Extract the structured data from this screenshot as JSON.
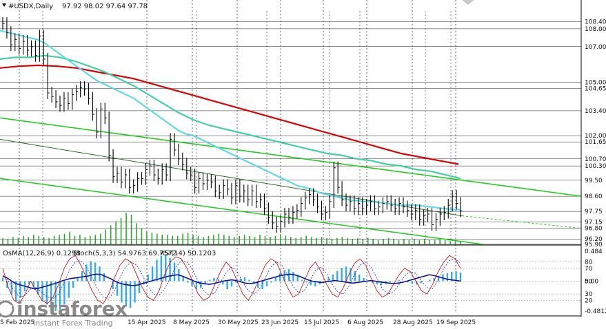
{
  "header": {
    "symbol": "#USDX,Daily",
    "ohlc": "97.92 98.02 97.64 97.78"
  },
  "indicator_header": {
    "osma": "OsMA(12,26,9) 0.1298",
    "stoch": "Stoch(5,3,3) 54.9763 69.7572",
    "rsi": "RSI(14) 50.1203"
  },
  "watermark": {
    "brand": "instaforex",
    "tagline": "Instant Forex Trading"
  },
  "colors": {
    "price": "#000000",
    "ma_fast": "#5fd8e8",
    "ma_mid": "#3fd2a0",
    "ma_slow": "#dd0000",
    "channel": "#22cc22",
    "volume": "#2ea52e",
    "osma_hist": "#33aaee",
    "stoch_main": "#cc0000",
    "stoch_signal": "#2222aa",
    "rsi": "#111199",
    "grid": "#000000"
  },
  "chart_data": [
    {
      "type": "line",
      "name": "#USDX,Daily",
      "price_levels": [
        "108.40",
        "108.00",
        "107.00",
        "105.00",
        "104.65",
        "103.40",
        "102.00",
        "101.65",
        "100.70",
        "100.30",
        "99.50",
        "98.60",
        "97.75",
        "97.15",
        "96.80",
        "96.20",
        "95.90"
      ],
      "ylim": [
        95.9,
        109
      ],
      "x_ticks": [
        "5 Feb 2025",
        "15 Apr 2025",
        "8 May 2025",
        "30 May 2025",
        "23 Jun 2025",
        "15 Jul 2025",
        "6 Aug 2025",
        "28 Aug 2025",
        "19 Sep 2025"
      ],
      "close": [
        108.3,
        107.8,
        107.1,
        107.4,
        106.9,
        107.3,
        106.8,
        107.0,
        106.5,
        107.6,
        106.3,
        104.4,
        104.2,
        103.9,
        103.7,
        104.1,
        103.8,
        104.3,
        104.5,
        104.7,
        104.6,
        104.1,
        103.2,
        102.2,
        103.5,
        103.0,
        100.9,
        99.7,
        99.9,
        99.4,
        99.8,
        99.1,
        99.2,
        99.6,
        99.6,
        100.1,
        100.3,
        99.8,
        99.6,
        100.1,
        99.8,
        101.8,
        101.2,
        100.7,
        100.4,
        99.9,
        99.8,
        99.1,
        99.6,
        99.3,
        99.5,
        99.4,
        98.9,
        98.8,
        99.2,
        99.0,
        98.5,
        99.2,
        98.6,
        98.9,
        98.4,
        98.9,
        98.3,
        98.4,
        97.9,
        97.4,
        97.1,
        96.9,
        97.2,
        97.6,
        97.4,
        97.7,
        97.8,
        98.2,
        98.5,
        98.7,
        98.4,
        98.0,
        97.6,
        97.7,
        98.3,
        100.2,
        99.1,
        98.4,
        98.1,
        98.3,
        97.9,
        98.2,
        97.9,
        98.1,
        98.3,
        97.9,
        98.0,
        98.2,
        98.3,
        98.1,
        97.9,
        98.2,
        98.0,
        97.8,
        97.6,
        97.8,
        97.3,
        97.5,
        97.6,
        97.0,
        97.3,
        97.6,
        97.7,
        98.1,
        98.6,
        98.2,
        97.78
      ],
      "ma_fast": [
        107.9,
        107.8,
        107.7,
        107.6,
        107.5,
        107.4,
        107.2,
        106.9,
        106.6,
        106.3,
        106.0,
        105.7,
        105.4,
        105.1,
        104.9,
        104.7,
        104.5,
        104.3,
        104.1,
        103.8,
        103.5,
        103.2,
        102.9,
        102.6,
        102.3,
        102.1,
        102.0,
        101.8,
        101.6,
        101.4,
        101.2,
        101.0,
        100.8,
        100.6,
        100.4,
        100.2,
        100.0,
        99.8,
        99.6,
        99.4,
        99.2,
        99.1,
        99.0,
        98.8,
        98.7,
        98.6,
        98.5,
        98.4,
        98.35,
        98.3,
        98.3,
        98.25,
        98.2,
        98.15,
        98.1,
        98.1,
        98.1,
        98.05,
        98.0,
        97.95,
        97.9,
        97.85,
        97.85
      ],
      "ma_mid": [
        106.3,
        106.4,
        106.4,
        106.5,
        106.4,
        106.2,
        105.9,
        105.6,
        105.2,
        104.8,
        104.3,
        103.8,
        103.3,
        102.9,
        102.6,
        102.4,
        102.2,
        102.0,
        101.8,
        101.6,
        101.4,
        101.2,
        101.0,
        100.9,
        100.7,
        100.6,
        100.4,
        100.3,
        100.1,
        100.0,
        99.8,
        99.6
      ],
      "ma_slow": [
        105.8,
        105.9,
        105.95,
        105.9,
        105.8,
        105.6,
        105.4,
        105.2,
        104.9,
        104.6,
        104.3,
        104.0,
        103.7,
        103.4,
        103.1,
        102.8,
        102.5,
        102.2,
        101.9,
        101.6,
        101.3,
        101.0,
        100.8,
        100.6,
        100.4
      ],
      "volume": [
        6,
        5,
        7,
        6,
        8,
        7,
        9,
        8,
        7,
        6,
        8,
        9,
        10,
        12,
        8,
        9,
        7,
        8,
        9,
        10,
        14,
        18,
        22,
        25,
        30,
        28,
        20,
        15,
        12,
        11,
        10,
        9,
        9,
        8,
        8,
        10,
        11,
        9,
        8,
        7,
        8,
        9,
        10,
        9,
        8,
        7,
        8,
        9,
        8,
        7,
        9,
        8,
        7,
        8,
        9,
        8,
        7,
        6,
        7,
        8,
        7,
        6,
        7,
        6,
        5,
        6,
        7,
        6,
        5,
        6,
        5,
        6,
        5,
        4,
        5,
        6,
        5,
        4,
        5,
        4,
        5,
        4,
        5,
        4,
        4,
        5,
        4,
        3,
        4,
        3
      ]
    },
    {
      "type": "line",
      "name": "OsMA(12,26,9) 0.1298 / Stoch(5,3,3) 54.9763 69.7572 / RSI(14) 50.1203",
      "y_labels": [
        "0.484",
        "80",
        "70",
        "0.00",
        "50",
        "30",
        "20",
        "-0.4812"
      ],
      "osma": [
        0.05,
        -0.1,
        -0.2,
        -0.3,
        -0.25,
        -0.15,
        -0.05,
        -0.1,
        -0.2,
        -0.3,
        -0.35,
        -0.4,
        -0.45,
        -0.42,
        -0.35,
        -0.25,
        -0.1,
        0.05,
        0.15,
        0.25,
        0.3,
        0.28,
        0.22,
        0.12,
        0.0,
        -0.12,
        -0.22,
        -0.32,
        -0.38,
        -0.4,
        -0.32,
        -0.18,
        -0.05,
        0.1,
        0.22,
        0.32,
        0.38,
        0.4,
        0.35,
        0.28,
        0.18,
        0.08,
        -0.02,
        -0.08,
        -0.12,
        -0.1,
        -0.05,
        0.02,
        0.05,
        0.03,
        -0.05,
        -0.12,
        -0.08,
        -0.02,
        0.04,
        0.06,
        0.02,
        -0.04,
        -0.1,
        -0.12,
        -0.08,
        -0.02,
        0.06,
        0.12,
        0.16,
        0.18,
        0.14,
        0.08,
        0.02,
        -0.02,
        -0.06,
        -0.08,
        -0.05,
        0.0,
        0.05,
        0.1,
        0.15,
        0.2,
        0.22,
        0.2,
        0.15,
        0.1,
        0.05,
        0.0,
        -0.03,
        -0.05,
        -0.06,
        -0.04,
        -0.02,
        0.0,
        0.02,
        0.0,
        -0.02,
        -0.04,
        -0.05,
        -0.03,
        0.0,
        0.02,
        0.05,
        0.08,
        0.1,
        0.12,
        0.14,
        0.15,
        0.13
      ],
      "stoch_main": [
        70,
        40,
        20,
        15,
        30,
        50,
        35,
        20,
        15,
        25,
        45,
        70,
        85,
        90,
        75,
        55,
        35,
        20,
        15,
        30,
        55,
        75,
        85,
        80,
        60,
        40,
        25,
        20,
        35,
        60,
        80,
        88,
        85,
        70,
        50,
        30,
        20,
        25,
        45,
        65,
        80,
        70,
        50,
        30,
        20,
        35,
        55,
        75,
        85,
        80,
        60,
        40,
        25,
        30,
        50,
        70,
        80,
        65,
        45,
        30,
        25,
        40,
        60,
        78,
        85,
        75,
        55,
        35,
        25,
        30,
        45,
        60,
        70,
        65,
        50,
        35,
        30,
        45,
        65,
        80,
        90,
        85,
        70
      ],
      "stoch_signal": [
        60,
        50,
        35,
        25,
        28,
        38,
        40,
        32,
        25,
        23,
        30,
        48,
        68,
        80,
        82,
        72,
        55,
        38,
        25,
        22,
        35,
        55,
        72,
        80,
        75,
        60,
        42,
        30,
        28,
        38,
        55,
        72,
        82,
        80,
        68,
        50,
        35,
        28,
        32,
        48,
        63,
        72,
        65,
        48,
        35,
        30,
        38,
        55,
        72,
        80,
        75,
        60,
        42,
        32,
        35,
        50,
        67,
        72,
        62,
        45,
        33,
        30,
        42,
        60,
        75,
        80,
        72,
        55,
        38,
        30,
        33,
        45,
        58,
        65,
        62,
        50,
        40,
        38,
        52,
        70,
        82,
        85,
        78
      ],
      "rsi": [
        58,
        55,
        50,
        46,
        44,
        42,
        40,
        38,
        39,
        41,
        43,
        45,
        47,
        50,
        52,
        54,
        55,
        56,
        57,
        58,
        60,
        61,
        60,
        57,
        54,
        50,
        47,
        45,
        44,
        43,
        44,
        46,
        48,
        50,
        52,
        54,
        56,
        58,
        59,
        60,
        58,
        55,
        52,
        49,
        47,
        46,
        45,
        46,
        48,
        50,
        51,
        52,
        51,
        49,
        47,
        46,
        47,
        49,
        51,
        53,
        55,
        57,
        59,
        60,
        61,
        60,
        58,
        55,
        52,
        50,
        49,
        48,
        49,
        50,
        51,
        50,
        49,
        48,
        47,
        48,
        49,
        50,
        51,
        50,
        49,
        48,
        47,
        46,
        47,
        48,
        50,
        52,
        54,
        56,
        58,
        60,
        59,
        57,
        55,
        53,
        52,
        51,
        50.12
      ]
    }
  ]
}
